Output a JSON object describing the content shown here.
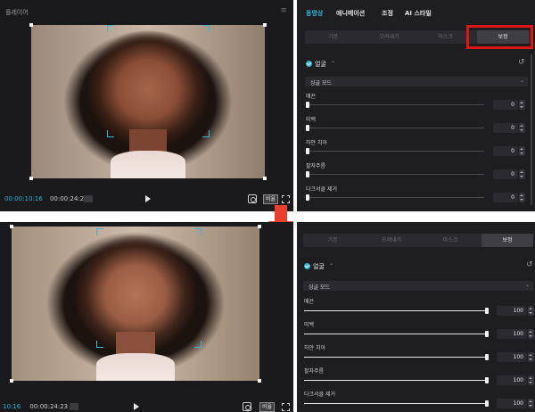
{
  "top": {
    "player": {
      "title": "플레이어",
      "time_current": "00:00:10:16",
      "time_total": "00:00:24:23",
      "ratio_label": "비율"
    },
    "panel": {
      "tabs": [
        {
          "label": "동영상",
          "active": true
        },
        {
          "label": "애니메이션",
          "active": false
        },
        {
          "label": "조정",
          "active": false
        },
        {
          "label": "AI 스타일",
          "active": false
        }
      ],
      "subtabs": [
        {
          "label": "기본",
          "active": false
        },
        {
          "label": "오려내기",
          "active": false
        },
        {
          "label": "마스크",
          "active": false
        },
        {
          "label": "보정",
          "active": true
        }
      ],
      "face_section": {
        "label": "얼굴",
        "mode": "싱글 모드"
      },
      "sliders": [
        {
          "label": "매끈",
          "value": "0",
          "fraction": 0.0
        },
        {
          "label": "미백",
          "value": "0",
          "fraction": 0.0
        },
        {
          "label": "하얀 치아",
          "value": "0",
          "fraction": 0.0
        },
        {
          "label": "팔자주름",
          "value": "0",
          "fraction": 0.0
        },
        {
          "label": "다크서클 제거",
          "value": "0",
          "fraction": 0.0
        }
      ]
    }
  },
  "bottom": {
    "player": {
      "time_current": "10:16",
      "time_total": "00:00:24:23",
      "ratio_label": "비율"
    },
    "panel": {
      "subtabs": [
        {
          "label": "기본",
          "active": false
        },
        {
          "label": "오려내기",
          "active": false
        },
        {
          "label": "마스크",
          "active": false
        },
        {
          "label": "보정",
          "active": true
        }
      ],
      "face_section": {
        "label": "얼굴",
        "mode": "싱글 모드"
      },
      "sliders": [
        {
          "label": "매끈",
          "value": "100",
          "fraction": 1.0
        },
        {
          "label": "미백",
          "value": "100",
          "fraction": 1.0
        },
        {
          "label": "하얀 치아",
          "value": "100",
          "fraction": 1.0
        },
        {
          "label": "팔자주름",
          "value": "100",
          "fraction": 1.0
        },
        {
          "label": "다크서클 제거",
          "value": "100",
          "fraction": 1.0
        }
      ]
    }
  },
  "colors": {
    "accent": "#2fb8d8",
    "highlight_red": "#e01515",
    "arrow": "#e8402e"
  },
  "icons": [
    "menu-icon",
    "play-icon",
    "screenshot-icon",
    "fullscreen-icon",
    "reset-icon",
    "chevron-down-icon",
    "check-icon",
    "down-arrow-icon"
  ]
}
